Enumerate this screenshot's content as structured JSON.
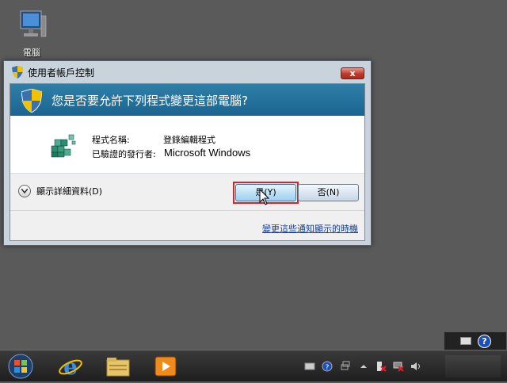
{
  "desktop": {
    "icons": [
      {
        "label": "電腦",
        "icon": "computer-icon"
      }
    ]
  },
  "dialog": {
    "title": "使用者帳戶控制",
    "close_label": "x",
    "question": "您是否要允許下列程式變更這部電腦?",
    "program_name_label": "程式名稱:",
    "program_name_value": "登錄編輯程式",
    "publisher_label": "已驗證的發行者:",
    "publisher_value": "Microsoft Windows",
    "details_label": "顯示詳細資料(D)",
    "yes_button": "是(Y)",
    "no_button": "否(N)",
    "change_notification_link": "變更這些通知顯示的時機"
  },
  "taskbar": {
    "apps": [
      "start-orb",
      "internet-explorer",
      "windows-explorer",
      "media-player"
    ],
    "tray_icons": [
      "keyboard-icon",
      "help-icon",
      "network-icon",
      "show-hidden-icon",
      "action-center-icon",
      "volume-icon"
    ]
  },
  "language_bar": {
    "help_label": "?"
  },
  "colors": {
    "banner": "#1a6590",
    "highlight_frame": "#e0202a",
    "link": "#0c3fa6"
  }
}
